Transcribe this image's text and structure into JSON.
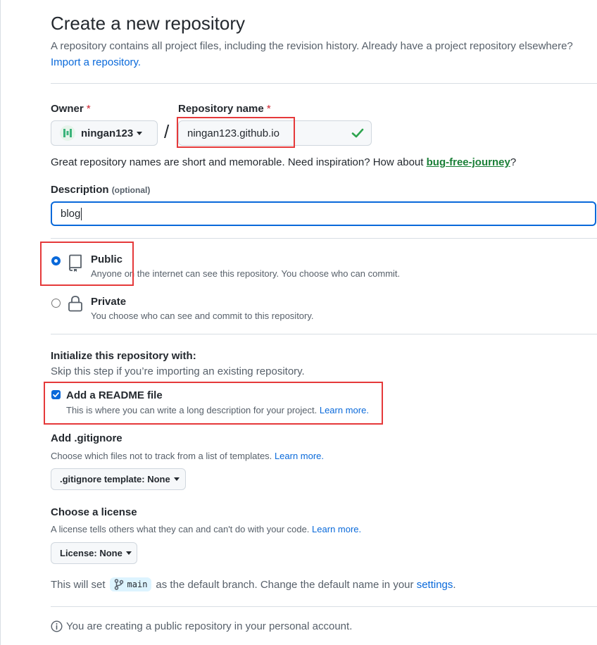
{
  "header": {
    "title": "Create a new repository",
    "subtitle": "A repository contains all project files, including the revision history. Already have a project repository elsewhere?",
    "import_link": "Import a repository."
  },
  "owner": {
    "label": "Owner",
    "required_mark": "*",
    "value": "ningan123"
  },
  "separator": "/",
  "repo_name": {
    "label": "Repository name",
    "required_mark": "*",
    "value": "ningan123.github.io",
    "valid": true
  },
  "name_hint": {
    "text": "Great repository names are short and memorable. Need inspiration? How about",
    "suggestion": "bug-free-journey",
    "suffix": "?"
  },
  "description": {
    "label": "Description",
    "optional": "(optional)",
    "value": "blog"
  },
  "visibility": {
    "public": {
      "label": "Public",
      "desc": "Anyone on the internet can see this repository. You choose who can commit.",
      "selected": true
    },
    "private": {
      "label": "Private",
      "desc": "You choose who can see and commit to this repository.",
      "selected": false
    }
  },
  "init": {
    "title": "Initialize this repository with:",
    "subtitle": "Skip this step if you’re importing an existing repository.",
    "readme": {
      "label": "Add a README file",
      "desc": "This is where you can write a long description for your project.",
      "learn_more": "Learn more.",
      "checked": true
    }
  },
  "gitignore": {
    "title": "Add .gitignore",
    "desc": "Choose which files not to track from a list of templates.",
    "learn_more": "Learn more.",
    "button": ".gitignore template: None"
  },
  "license": {
    "title": "Choose a license",
    "desc": "A license tells others what they can and can't do with your code.",
    "learn_more": "Learn more.",
    "button": "License: None"
  },
  "branch": {
    "prefix": "This will set",
    "name": "main",
    "middle": "as the default branch. Change the default name in your",
    "settings_link": "settings",
    "suffix": "."
  },
  "notice": "You are creating a public repository in your personal account.",
  "colors": {
    "accent": "#0969da",
    "success": "#1a7f37",
    "highlight": "#e5393a"
  }
}
